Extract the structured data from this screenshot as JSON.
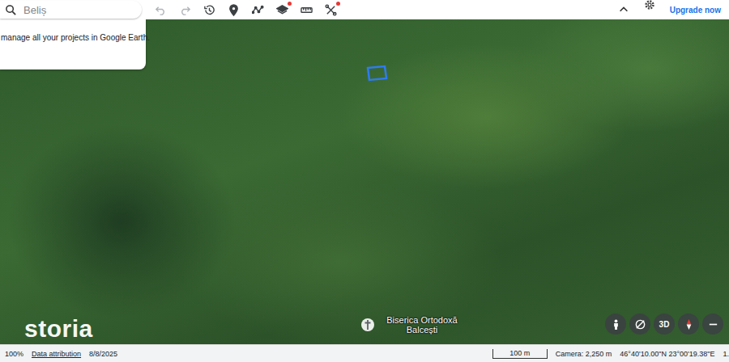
{
  "search": {
    "placeholder": "Beliș"
  },
  "toolbar": [
    {
      "kind": "undo",
      "disabled": true,
      "badge": false
    },
    {
      "kind": "redo",
      "disabled": true,
      "badge": false
    },
    {
      "kind": "history",
      "disabled": false,
      "badge": false
    },
    {
      "kind": "pin",
      "disabled": false,
      "badge": false
    },
    {
      "kind": "path",
      "disabled": false,
      "badge": false
    },
    {
      "kind": "layers",
      "disabled": false,
      "badge": true
    },
    {
      "kind": "ruler",
      "disabled": false,
      "badge": false
    },
    {
      "kind": "tools",
      "disabled": false,
      "badge": true
    }
  ],
  "upgrade": "Upgrade now",
  "panel": {
    "text": "manage all your projects in Google Earth."
  },
  "watermark": "storia",
  "places": [
    {
      "label": "Biserica Ortodoxă Balcești"
    }
  ],
  "map_controls": [
    {
      "kind": "pegman",
      "label": ""
    },
    {
      "kind": "tilt",
      "label": ""
    },
    {
      "kind": "text",
      "label": "3D"
    },
    {
      "kind": "compass",
      "label": ""
    },
    {
      "kind": "zoom-out",
      "label": ""
    }
  ],
  "status_bar": {
    "zoom": "100%",
    "attribution": "Data attribution",
    "date": "8/8/2025",
    "scale": "100 m",
    "camera": "Camera: 2,250 m",
    "coordinates": "46°40'10.00\"N 23°00'19.38\"E",
    "extra": "1."
  }
}
